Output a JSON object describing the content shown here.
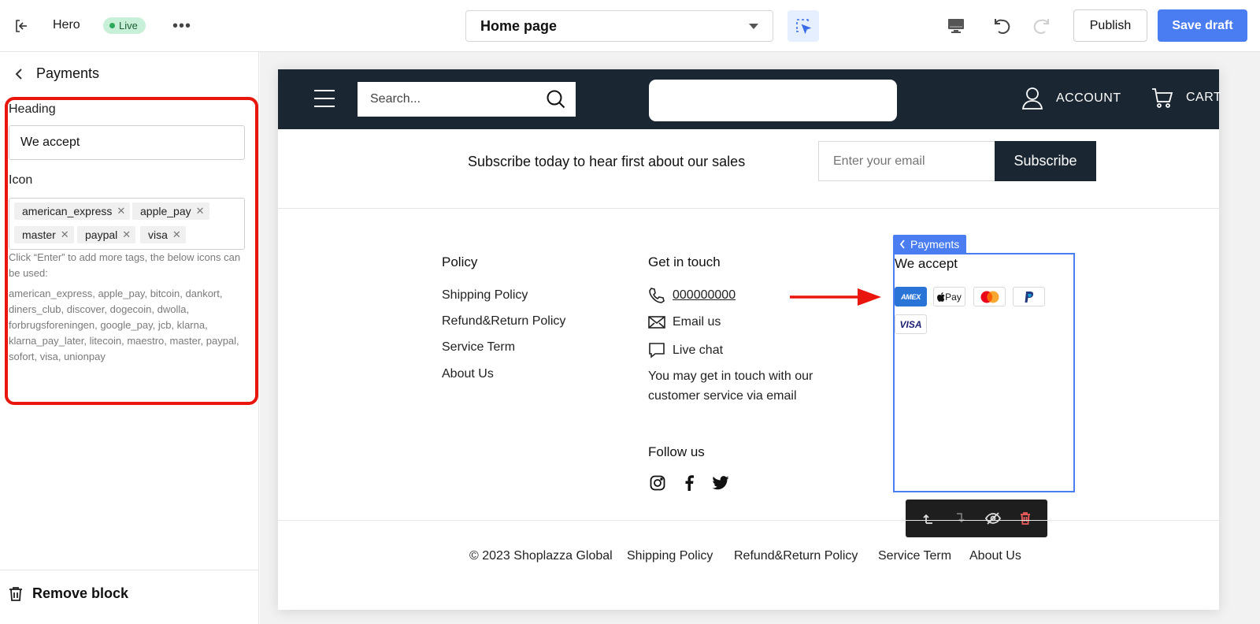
{
  "topbar": {
    "theme_name": "Hero",
    "status": "Live",
    "more": "•••",
    "page_selector": "Home page",
    "publish_label": "Publish",
    "save_label": "Save draft"
  },
  "sidebar": {
    "title": "Payments",
    "heading_label": "Heading",
    "heading_value": "We accept",
    "icon_label": "Icon",
    "tags": [
      "american_express",
      "apple_pay",
      "master",
      "paypal",
      "visa"
    ],
    "help_text": "Click “Enter” to add more tags, the below icons can be used:",
    "available_icons": "american_express, apple_pay, bitcoin, dankort, diners_club, discover, dogecoin, dwolla, forbrugsforeningen, google_pay, jcb, klarna, klarna_pay_later, litecoin, maestro, master, paypal, sofort, visa, unionpay",
    "remove_label": "Remove block"
  },
  "store": {
    "search_placeholder": "Search...",
    "account_label": "ACCOUNT",
    "cart_label": "CART",
    "subscribe_text": "Subscribe today to hear first about our sales",
    "email_placeholder": "Enter your email",
    "subscribe_label": "Subscribe",
    "policy": {
      "title": "Policy",
      "links": [
        "Shipping Policy",
        "Refund&Return Policy",
        "Service Term",
        "About Us"
      ]
    },
    "contact": {
      "title": "Get in touch",
      "phone": "000000000",
      "email": "Email us",
      "chat": "Live chat",
      "description": "You may get in touch with our customer service via email"
    },
    "follow_title": "Follow us",
    "payments": {
      "tab_label": "Payments",
      "heading": "We accept",
      "icons": {
        "amex": "AMEX",
        "applepay": "Pay",
        "visa": "VISA"
      }
    },
    "bottom": {
      "copyright": "© 2023 Shoplazza Global",
      "links": [
        "Shipping Policy",
        "Refund&Return Policy",
        "Service Term",
        "About Us"
      ]
    }
  },
  "colors": {
    "accent": "#4a7cf2",
    "store_dark": "#1b2633",
    "highlight_red": "#e8160c",
    "live_green": "#2da75a"
  }
}
